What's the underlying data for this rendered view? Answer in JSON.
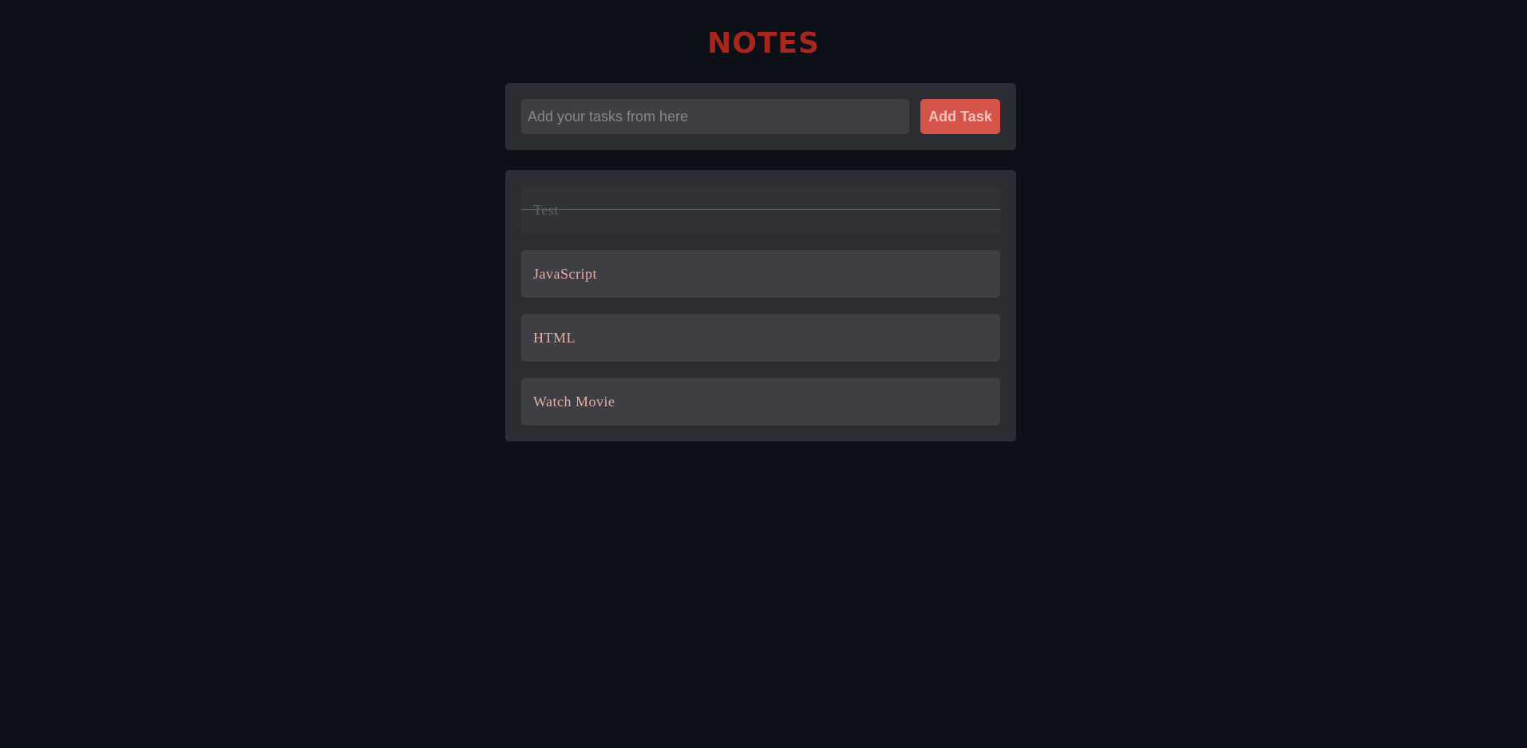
{
  "header": {
    "title": "NOTES"
  },
  "task_form": {
    "placeholder": "Add your tasks from here",
    "value": "",
    "add_button_label": "Add Task"
  },
  "tasks": [
    {
      "label": "Test",
      "completed": true
    },
    {
      "label": "JavaScript",
      "completed": false
    },
    {
      "label": "HTML",
      "completed": false
    },
    {
      "label": "Watch Movie",
      "completed": false
    }
  ],
  "colors": {
    "background": "#0d1017",
    "card": "#2b2d33",
    "item": "#3d3f45",
    "title": "#a8261c",
    "accent_button": "#d5544a",
    "task_text": "#e8ada5"
  }
}
